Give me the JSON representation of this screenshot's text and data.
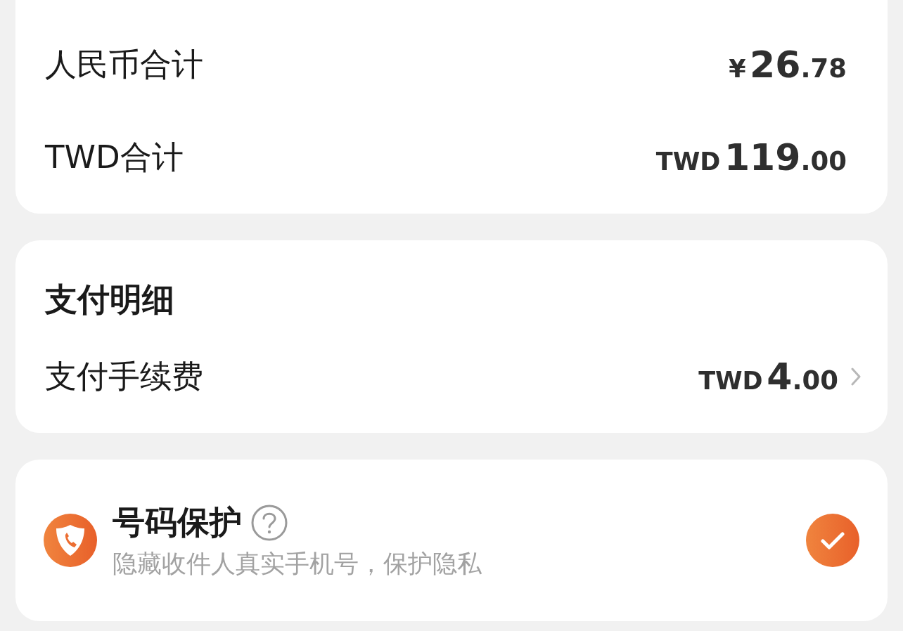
{
  "totals": [
    {
      "label": "人民币合计",
      "currency": "¥",
      "integer": "26",
      "decimal": ".78"
    },
    {
      "label": "TWD合计",
      "currency": "TWD",
      "integer": "119",
      "decimal": ".00"
    }
  ],
  "payment_details": {
    "title": "支付明细",
    "rows": [
      {
        "label": "支付手续费",
        "currency": "TWD",
        "integer": "4",
        "decimal": ".00",
        "has_arrow": true
      }
    ]
  },
  "number_protection": {
    "title": "号码保护",
    "help": true,
    "description": "隐藏收件人真实手机号，保护隐私",
    "checked": true
  }
}
